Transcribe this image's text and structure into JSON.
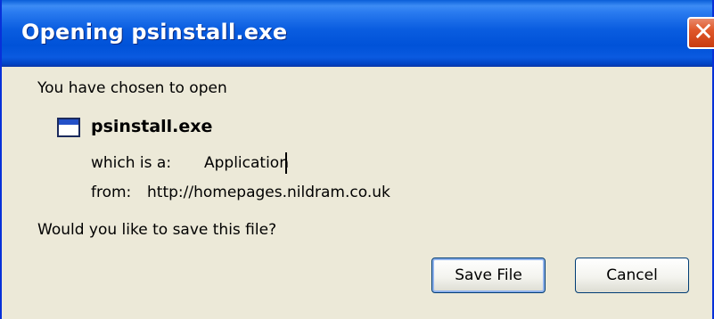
{
  "window": {
    "title": "Opening psinstall.exe",
    "close_glyph": "✕"
  },
  "dialog": {
    "intro": "You have chosen to open",
    "file": {
      "icon": "application-window-icon",
      "name": "psinstall.exe"
    },
    "type_label": "which is a:",
    "type_value": "Application",
    "from_label": "from:",
    "from_value": "http://homepages.nildram.co.uk",
    "question": "Would you like to save this file?"
  },
  "buttons": {
    "save_label": "Save File",
    "cancel_label": "Cancel"
  },
  "colors": {
    "title_bar": "#0a5de0",
    "close_button": "#e0582a",
    "dialog_background": "#ece9d8",
    "default_button_focus": "#8fb2ec"
  }
}
